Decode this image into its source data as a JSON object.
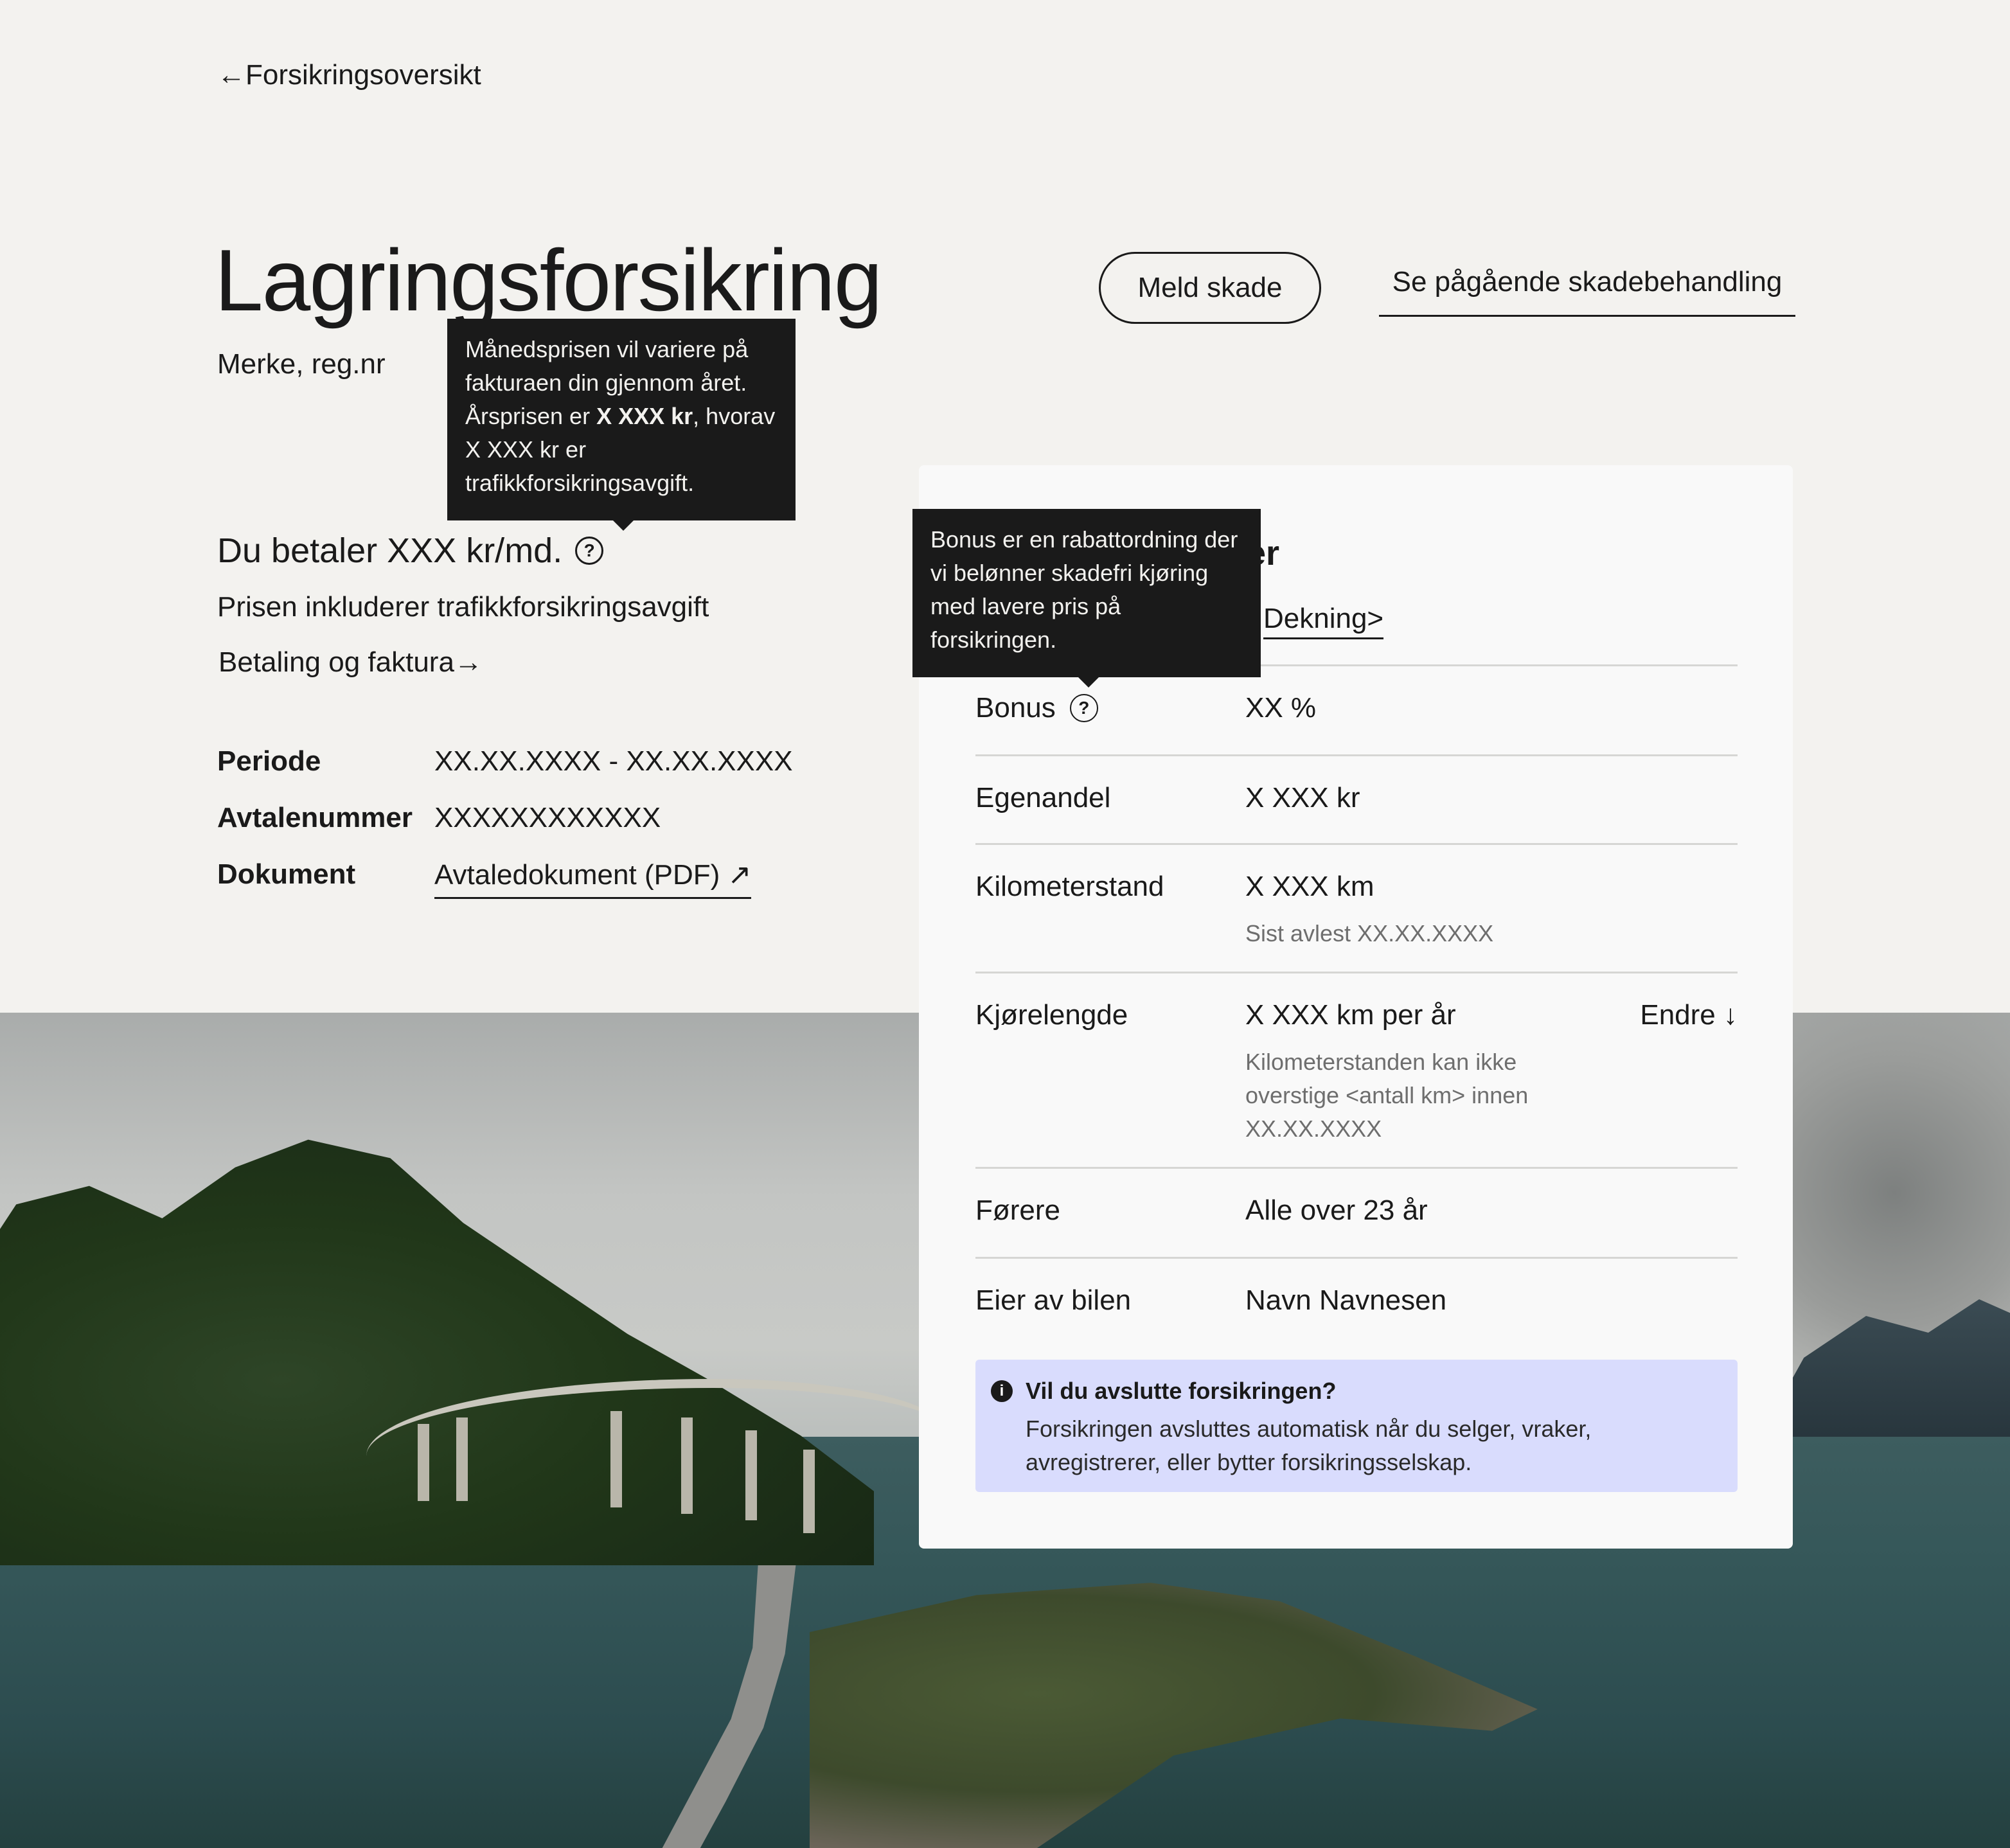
{
  "nav": {
    "back_label": "←Forsikringsoversikt"
  },
  "header": {
    "title": "Lagringsforsikring",
    "subtitle": "Merke, reg.nr",
    "report_button": "Meld skade",
    "ongoing_link": "Se pågående skadebehandling"
  },
  "price": {
    "heading": "Du betaler XXX kr/md.",
    "note": "Prisen inkluderer trafikkforsikringsavgift",
    "payment_link": "Betaling og faktura→"
  },
  "price_tooltip": {
    "part1": "Månedsprisen vil variere på fakturaen din gjennom året. Årsprisen er ",
    "bold": "X XXX kr",
    "part2": ", hvorav X XXX kr er trafikkforsikringsavgift."
  },
  "meta": {
    "period_label": "Periode",
    "period_value": "XX.XX.XXXX - XX.XX.XXXX",
    "agreement_label": "Avtalenummer",
    "agreement_value": "XXXXXXXXXXXX",
    "document_label": "Dokument",
    "document_link": "Avtaledokument (PDF) ↗"
  },
  "card": {
    "heading_tail": "er",
    "dekning_link": "Dekning>",
    "rows": {
      "bonus_label": "Bonus",
      "bonus_value": "XX %",
      "deductible_label": "Egenandel",
      "deductible_value": "X XXX kr",
      "odometer_label": "Kilometerstand",
      "odometer_value": "X XXX km",
      "odometer_sub": "Sist avlest XX.XX.XXXX",
      "mileage_label": "Kjørelengde",
      "mileage_value": "X XXX km per år",
      "mileage_sub": "Kilometerstanden kan ikke overstige <antall km> innen XX.XX.XXXX",
      "mileage_action": "Endre ↓",
      "drivers_label": "Førere",
      "drivers_value": "Alle over 23 år",
      "owner_label": "Eier av bilen",
      "owner_value": "Navn Navnesen"
    },
    "alert": {
      "title": "Vil du avslutte forsikringen?",
      "body": "Forsikringen avsluttes automatisk når du selger, vraker, avregistrerer, eller bytter forsikringsselskap."
    }
  },
  "bonus_tooltip": {
    "text": "Bonus er en rabattordning der vi belønner skadefri kjøring med lavere pris på forsikringen."
  },
  "icons": {
    "help": "question-circle-icon",
    "info": "info-circle-icon"
  },
  "colors": {
    "background": "#f3f2ef",
    "card": "#f9f9f9",
    "tooltip": "#1a1a1a",
    "alert": "#d9dcfd"
  }
}
